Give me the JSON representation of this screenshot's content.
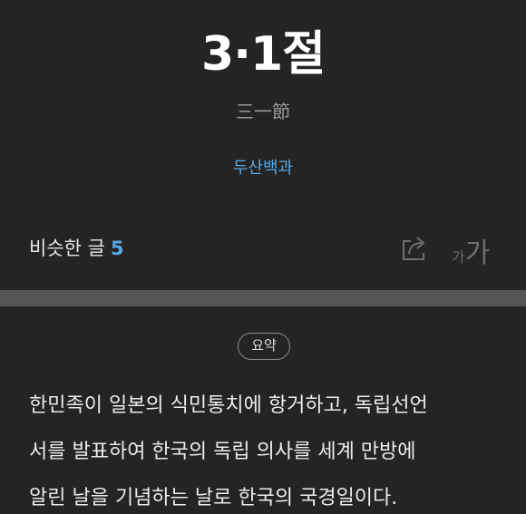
{
  "article": {
    "title": "3·1절",
    "hanja": "三一節",
    "source": "두산백과"
  },
  "toolbar": {
    "similar_label": "비슷한 글",
    "similar_count": "5",
    "share_icon": "share-icon",
    "font_size_small": "가",
    "font_size_large": "가"
  },
  "summary": {
    "badge": "요약",
    "lines": [
      "한민족이 일본의 식민통치에 항거하고, 독립선언",
      "서를 발표하여 한국의 독립 의사를 세계 만방에",
      "알린 날을 기념하는 날로 한국의 국경일이다."
    ]
  },
  "colors": {
    "background": "#242424",
    "accent": "#5aa9e6",
    "divider": "#555555"
  }
}
